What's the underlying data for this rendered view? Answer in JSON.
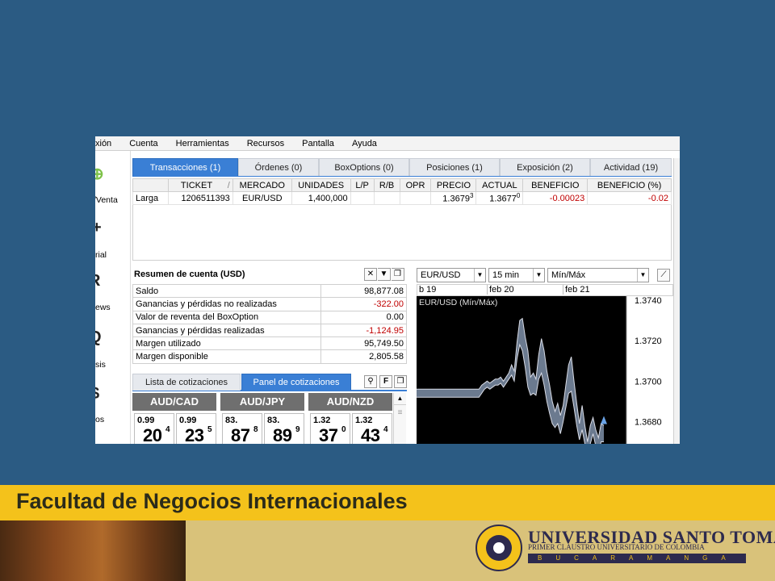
{
  "menu": [
    "xión",
    "Cuenta",
    "Herramientas",
    "Recursos",
    "Pantalla",
    "Ayuda"
  ],
  "left_nav": [
    {
      "label": "/Venta",
      "icon": "plus-circle-icon",
      "glyph": "⊕"
    },
    {
      "label": "rial",
      "icon": "chart-icon",
      "glyph": "+"
    },
    {
      "label": "ews",
      "icon": "news-icon",
      "glyph": "R"
    },
    {
      "label": "sis",
      "icon": "search-icon",
      "glyph": "Q"
    },
    {
      "label": "os",
      "icon": "dollar-icon",
      "glyph": "$"
    }
  ],
  "position_tabs": [
    "Transacciones (1)",
    "Órdenes (0)",
    "BoxOptions (0)",
    "Posiciones (1)",
    "Exposición (2)",
    "Actividad (19)"
  ],
  "position_columns": [
    "",
    "TICKET",
    "MERCADO",
    "UNIDADES",
    "L/P",
    "R/B",
    "OPR",
    "PRECIO",
    "ACTUAL",
    "BENEFICIO",
    "BENEFICIO (%)"
  ],
  "positions": [
    {
      "side": "Larga",
      "ticket": "1206511393",
      "market": "EUR/USD",
      "units": "1,400,000",
      "lp": "",
      "rb": "",
      "opr": "",
      "price": "1.3679",
      "price_sup": "3",
      "current": "1.3677",
      "current_sup": "0",
      "profit": "-0.00023",
      "profit_pct": "-0.02"
    }
  ],
  "account": {
    "title": "Resumen de cuenta (USD)",
    "rows": [
      {
        "label": "Saldo",
        "value": "98,877.08",
        "negative": false
      },
      {
        "label": "Ganancias y pérdidas no realizadas",
        "value": "-322.00",
        "negative": true
      },
      {
        "label": "Valor de reventa del BoxOption",
        "value": "0.00",
        "negative": false
      },
      {
        "label": "Ganancias y pérdidas realizadas",
        "value": "-1,124.95",
        "negative": true
      },
      {
        "label": "Margen utilizado",
        "value": "95,749.50",
        "negative": false
      },
      {
        "label": "Margen disponible",
        "value": "2,805.58",
        "negative": false
      }
    ]
  },
  "quote_tabs": [
    "Lista de cotizaciones",
    "Panel de cotizaciones"
  ],
  "quotes": [
    {
      "pair": "AUD/CAD",
      "bid_small": "0.99",
      "bid_big": "20",
      "bid_sup": "4",
      "ask_small": "0.99",
      "ask_big": "23",
      "ask_sup": "5"
    },
    {
      "pair": "AUD/JPY",
      "bid_small": "83.",
      "bid_big": "87",
      "bid_sup": "8",
      "ask_small": "83.",
      "ask_big": "89",
      "ask_sup": "9"
    },
    {
      "pair": "AUD/NZD",
      "bid_small": "1.32",
      "bid_big": "37",
      "bid_sup": "0",
      "ask_small": "1.32",
      "ask_big": "43",
      "ask_sup": "4"
    }
  ],
  "chart_toolbar": {
    "instrument": "EUR/USD",
    "interval": "15 min",
    "mode": "Mín/Máx"
  },
  "chart_data": {
    "type": "line",
    "title": "EUR/USD (Mín/Máx)",
    "date_labels": [
      "b 19",
      "feb 20",
      "feb 21"
    ],
    "yticks": [
      "1.3740",
      "1.3720",
      "1.3700",
      "1.3680"
    ],
    "ylim": [
      1.3669,
      1.3742
    ],
    "series": [
      {
        "name": "Máx",
        "values": [
          1.3696,
          1.3696,
          1.3696,
          1.3696,
          1.3696,
          1.3696,
          1.3696,
          1.3696,
          1.3696,
          1.3696,
          1.3696,
          1.3696,
          1.3696,
          1.3696,
          1.3696,
          1.3696,
          1.3696,
          1.3696,
          1.3696,
          1.3696,
          1.3696,
          1.3696,
          1.3696,
          1.3696,
          1.3698,
          1.3699,
          1.37,
          1.3699,
          1.37,
          1.3701,
          1.3701,
          1.3702,
          1.37,
          1.3702,
          1.3704,
          1.3708,
          1.3705,
          1.3719,
          1.373,
          1.3731,
          1.3722,
          1.3715,
          1.3702,
          1.3704,
          1.3701,
          1.3713,
          1.3721,
          1.3715,
          1.3705,
          1.3698,
          1.369,
          1.3685,
          1.3689,
          1.3683,
          1.3688,
          1.3698,
          1.3708,
          1.3712,
          1.37,
          1.3689,
          1.3679,
          1.3688,
          1.3678,
          1.367,
          1.3678,
          1.3682,
          1.3676,
          1.3672,
          1.3679,
          1.3678
        ]
      },
      {
        "name": "Mín",
        "values": [
          1.3692,
          1.3692,
          1.3692,
          1.3692,
          1.3692,
          1.3692,
          1.3692,
          1.3692,
          1.3692,
          1.3692,
          1.3692,
          1.3692,
          1.3692,
          1.3692,
          1.3692,
          1.3692,
          1.3692,
          1.3692,
          1.3692,
          1.3692,
          1.3692,
          1.3692,
          1.3692,
          1.3692,
          1.3694,
          1.3696,
          1.3697,
          1.3696,
          1.3697,
          1.3698,
          1.3698,
          1.3699,
          1.3697,
          1.3699,
          1.3701,
          1.3703,
          1.37,
          1.3711,
          1.3718,
          1.3715,
          1.3707,
          1.3697,
          1.3693,
          1.3694,
          1.3693,
          1.3701,
          1.3704,
          1.3698,
          1.369,
          1.3684,
          1.3679,
          1.3677,
          1.3679,
          1.3674,
          1.368,
          1.3687,
          1.3694,
          1.3695,
          1.3687,
          1.3678,
          1.3671,
          1.3676,
          1.3669,
          1.3662,
          1.3669,
          1.3674,
          1.3668,
          1.3664,
          1.367,
          1.367
        ]
      }
    ],
    "colors": {
      "background": "#000000",
      "fill": "#6b7a8f",
      "line": "#d8dbe5",
      "marker": "#6aa3e6"
    }
  },
  "footer": {
    "title": "Facultad de Negocios Internacionales",
    "university": "UNIVERSIDAD SANTO TOMAS",
    "subtitle": "PRIMER CLAUSTRO UNIVERSITARIO DE COLOMBIA",
    "city": "BUCARAMANGA"
  },
  "colors": {
    "slide_bg": "#2b5b83",
    "accent_tab": "#3a7fd5",
    "footer_bar": "#f4c21b",
    "negative": "#c00000"
  }
}
